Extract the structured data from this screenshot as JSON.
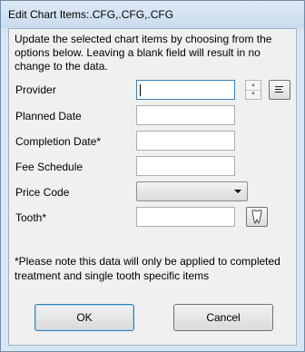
{
  "window": {
    "title": "Edit Chart Items:.CFG,.CFG,.CFG"
  },
  "instructions": "Update the selected chart items by choosing from the options below. Leaving a blank field will result in no change to the data.",
  "fields": {
    "provider": {
      "label": "Provider",
      "value": ""
    },
    "planned_date": {
      "label": "Planned Date",
      "value": ""
    },
    "completion_date": {
      "label": "Completion Date*",
      "value": ""
    },
    "fee_schedule": {
      "label": "Fee Schedule",
      "value": ""
    },
    "price_code": {
      "label": "Price Code",
      "selected": ""
    },
    "tooth": {
      "label": "Tooth*",
      "value": ""
    }
  },
  "icons": {
    "provider_spinner": "spinner-arrows-icon",
    "provider_picker": "list-lines-icon",
    "tooth_picker": "tooth-icon"
  },
  "note": "*Please note this data will only be applied to completed treatment and single tooth specific items",
  "buttons": {
    "ok": "OK",
    "cancel": "Cancel"
  }
}
